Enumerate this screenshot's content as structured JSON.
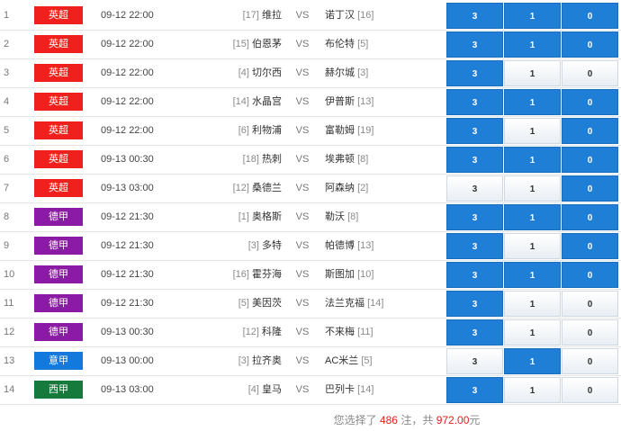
{
  "colors": {
    "league_epl": "#f0201e",
    "league_bundesliga": "#8b1aa6",
    "league_seriea": "#1479dc",
    "league_laliga": "#167a3c",
    "selected": "#1f7fd6"
  },
  "vs_label": "VS",
  "option_labels": [
    "3",
    "1",
    "0"
  ],
  "matches": [
    {
      "num": "1",
      "league": "英超",
      "league_color": "#f0201e",
      "time": "09-12 22:00",
      "home_rank": "[17]",
      "home": "维拉",
      "away": "诺丁汉",
      "away_rank": "[16]",
      "selected": [
        true,
        true,
        true
      ]
    },
    {
      "num": "2",
      "league": "英超",
      "league_color": "#f0201e",
      "time": "09-12 22:00",
      "home_rank": "[15]",
      "home": "伯恩茅",
      "away": "布伦特",
      "away_rank": "[5]",
      "selected": [
        true,
        true,
        true
      ]
    },
    {
      "num": "3",
      "league": "英超",
      "league_color": "#f0201e",
      "time": "09-12 22:00",
      "home_rank": "[4]",
      "home": "切尔西",
      "away": "赫尔城",
      "away_rank": "[3]",
      "selected": [
        true,
        false,
        false
      ]
    },
    {
      "num": "4",
      "league": "英超",
      "league_color": "#f0201e",
      "time": "09-12 22:00",
      "home_rank": "[14]",
      "home": "水晶宫",
      "away": "伊普斯",
      "away_rank": "[13]",
      "selected": [
        true,
        true,
        true
      ]
    },
    {
      "num": "5",
      "league": "英超",
      "league_color": "#f0201e",
      "time": "09-12 22:00",
      "home_rank": "[6]",
      "home": "利物浦",
      "away": "富勒姆",
      "away_rank": "[19]",
      "selected": [
        true,
        false,
        true
      ]
    },
    {
      "num": "6",
      "league": "英超",
      "league_color": "#f0201e",
      "time": "09-13 00:30",
      "home_rank": "[18]",
      "home": "热刺",
      "away": "埃弗顿",
      "away_rank": "[8]",
      "selected": [
        true,
        true,
        true
      ]
    },
    {
      "num": "7",
      "league": "英超",
      "league_color": "#f0201e",
      "time": "09-13 03:00",
      "home_rank": "[12]",
      "home": "桑德兰",
      "away": "阿森纳",
      "away_rank": "[2]",
      "selected": [
        false,
        false,
        true
      ]
    },
    {
      "num": "8",
      "league": "德甲",
      "league_color": "#8b1aa6",
      "time": "09-12 21:30",
      "home_rank": "[1]",
      "home": "奥格斯",
      "away": "勒沃",
      "away_rank": "[8]",
      "selected": [
        true,
        true,
        true
      ]
    },
    {
      "num": "9",
      "league": "德甲",
      "league_color": "#8b1aa6",
      "time": "09-12 21:30",
      "home_rank": "[3]",
      "home": "多特",
      "away": "帕德博",
      "away_rank": "[13]",
      "selected": [
        true,
        false,
        true
      ]
    },
    {
      "num": "10",
      "league": "德甲",
      "league_color": "#8b1aa6",
      "time": "09-12 21:30",
      "home_rank": "[16]",
      "home": "霍芬海",
      "away": "斯图加",
      "away_rank": "[10]",
      "selected": [
        true,
        true,
        true
      ]
    },
    {
      "num": "11",
      "league": "德甲",
      "league_color": "#8b1aa6",
      "time": "09-12 21:30",
      "home_rank": "[5]",
      "home": "美因茨",
      "away": "法兰克福",
      "away_rank": "[14]",
      "selected": [
        true,
        false,
        false
      ]
    },
    {
      "num": "12",
      "league": "德甲",
      "league_color": "#8b1aa6",
      "time": "09-13 00:30",
      "home_rank": "[12]",
      "home": "科隆",
      "away": "不来梅",
      "away_rank": "[11]",
      "selected": [
        true,
        false,
        false
      ]
    },
    {
      "num": "13",
      "league": "意甲",
      "league_color": "#1479dc",
      "time": "09-13 00:00",
      "home_rank": "[3]",
      "home": "拉齐奥",
      "away": "AC米兰",
      "away_rank": "[5]",
      "selected": [
        false,
        true,
        false
      ]
    },
    {
      "num": "14",
      "league": "西甲",
      "league_color": "#167a3c",
      "time": "09-13 03:00",
      "home_rank": "[4]",
      "home": "皇马",
      "away": "巴列卡",
      "away_rank": "[14]",
      "selected": [
        true,
        false,
        false
      ]
    }
  ],
  "summary": {
    "prefix": "您选择了",
    "count": "486",
    "mid": "注，共",
    "amount": "972.00",
    "suffix": "元"
  }
}
